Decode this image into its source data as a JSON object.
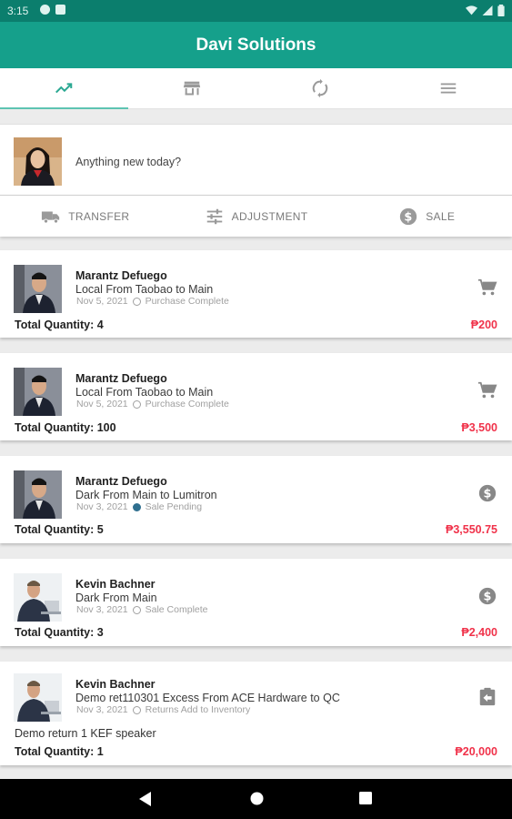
{
  "status_bar": {
    "time": "3:15"
  },
  "app": {
    "title": "Davi Solutions"
  },
  "tabs": [
    {
      "icon": "trending-icon",
      "active": true
    },
    {
      "icon": "store-icon",
      "active": false
    },
    {
      "icon": "sync-icon",
      "active": false
    },
    {
      "icon": "menu-icon",
      "active": false
    }
  ],
  "composer": {
    "placeholder": "Anything new today?"
  },
  "actions": [
    {
      "label": "TRANSFER",
      "icon": "truck-icon"
    },
    {
      "label": "ADJUSTMENT",
      "icon": "tune-icon"
    },
    {
      "label": "SALE",
      "icon": "dollar-icon"
    }
  ],
  "transactions": [
    {
      "name": "Marantz Defuego",
      "description": "Local From Taobao to Main",
      "date": "Nov 5, 2021",
      "status": "Purchase Complete",
      "icon": "cart-icon",
      "total_quantity": "Total Quantity: 4",
      "amount": "₱200"
    },
    {
      "name": "Marantz Defuego",
      "description": "Local From Taobao to Main",
      "date": "Nov 5, 2021",
      "status": "Purchase Complete",
      "icon": "cart-icon",
      "total_quantity": "Total Quantity: 100",
      "amount": "₱3,500"
    },
    {
      "name": "Marantz Defuego",
      "description": "Dark From Main to Lumitron",
      "date": "Nov 3, 2021",
      "status": "Sale Pending",
      "icon": "dollar-icon",
      "total_quantity": "Total Quantity: 5",
      "amount": "₱3,550.75"
    },
    {
      "name": "Kevin Bachner",
      "description": "Dark From Main",
      "date": "Nov 3, 2021",
      "status": "Sale Complete",
      "icon": "dollar-icon",
      "total_quantity": "Total Quantity: 3",
      "amount": "₱2,400"
    },
    {
      "name": "Kevin Bachner",
      "description": "Demo ret110301 Excess From ACE Hardware to QC",
      "date": "Nov 3, 2021",
      "status": "Returns Add to Inventory",
      "icon": "return-box-icon",
      "note": "Demo return 1 KEF speaker",
      "total_quantity": "Total Quantity: 1",
      "amount": "₱20,000"
    }
  ],
  "colors": {
    "app_bar": "#15a08b",
    "status_bar": "#0b7e6d",
    "amount": "#f0324a",
    "tab_indicator": "#5ec4b2"
  }
}
